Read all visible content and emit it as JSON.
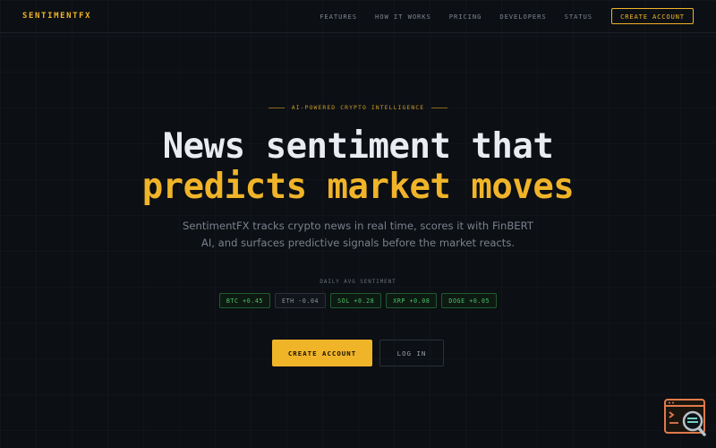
{
  "nav": {
    "logo": "SENTIMENTFX",
    "links": [
      "FEATURES",
      "HOW IT WORKS",
      "PRICING",
      "DEVELOPERS",
      "STATUS"
    ],
    "cta": "CREATE ACCOUNT"
  },
  "hero": {
    "eyebrow": "AI-POWERED CRYPTO INTELLIGENCE",
    "headline_line1": "News sentiment that",
    "headline_line2": "predicts market moves",
    "subtitle": "SentimentFX tracks crypto news in real time, scores it with FinBERT AI, and surfaces predictive signals before the market reacts.",
    "sentiment_label": "DAILY AVG SENTIMENT",
    "chips": [
      {
        "text": "BTC +0.45",
        "tone": "positive"
      },
      {
        "text": "ETH -0.04",
        "tone": "neutral"
      },
      {
        "text": "SOL +0.28",
        "tone": "positive"
      },
      {
        "text": "XRP +0.08",
        "tone": "positive"
      },
      {
        "text": "DOGE +0.05",
        "tone": "positive"
      }
    ],
    "primary_button": "CREATE ACCOUNT",
    "secondary_button": "LOG IN"
  },
  "widget": {
    "icon": "console-search-icon"
  },
  "colors": {
    "background": "#0c0f14",
    "accent": "#f0b429",
    "positive": "#4cc06a",
    "neutral": "#8d949e"
  }
}
